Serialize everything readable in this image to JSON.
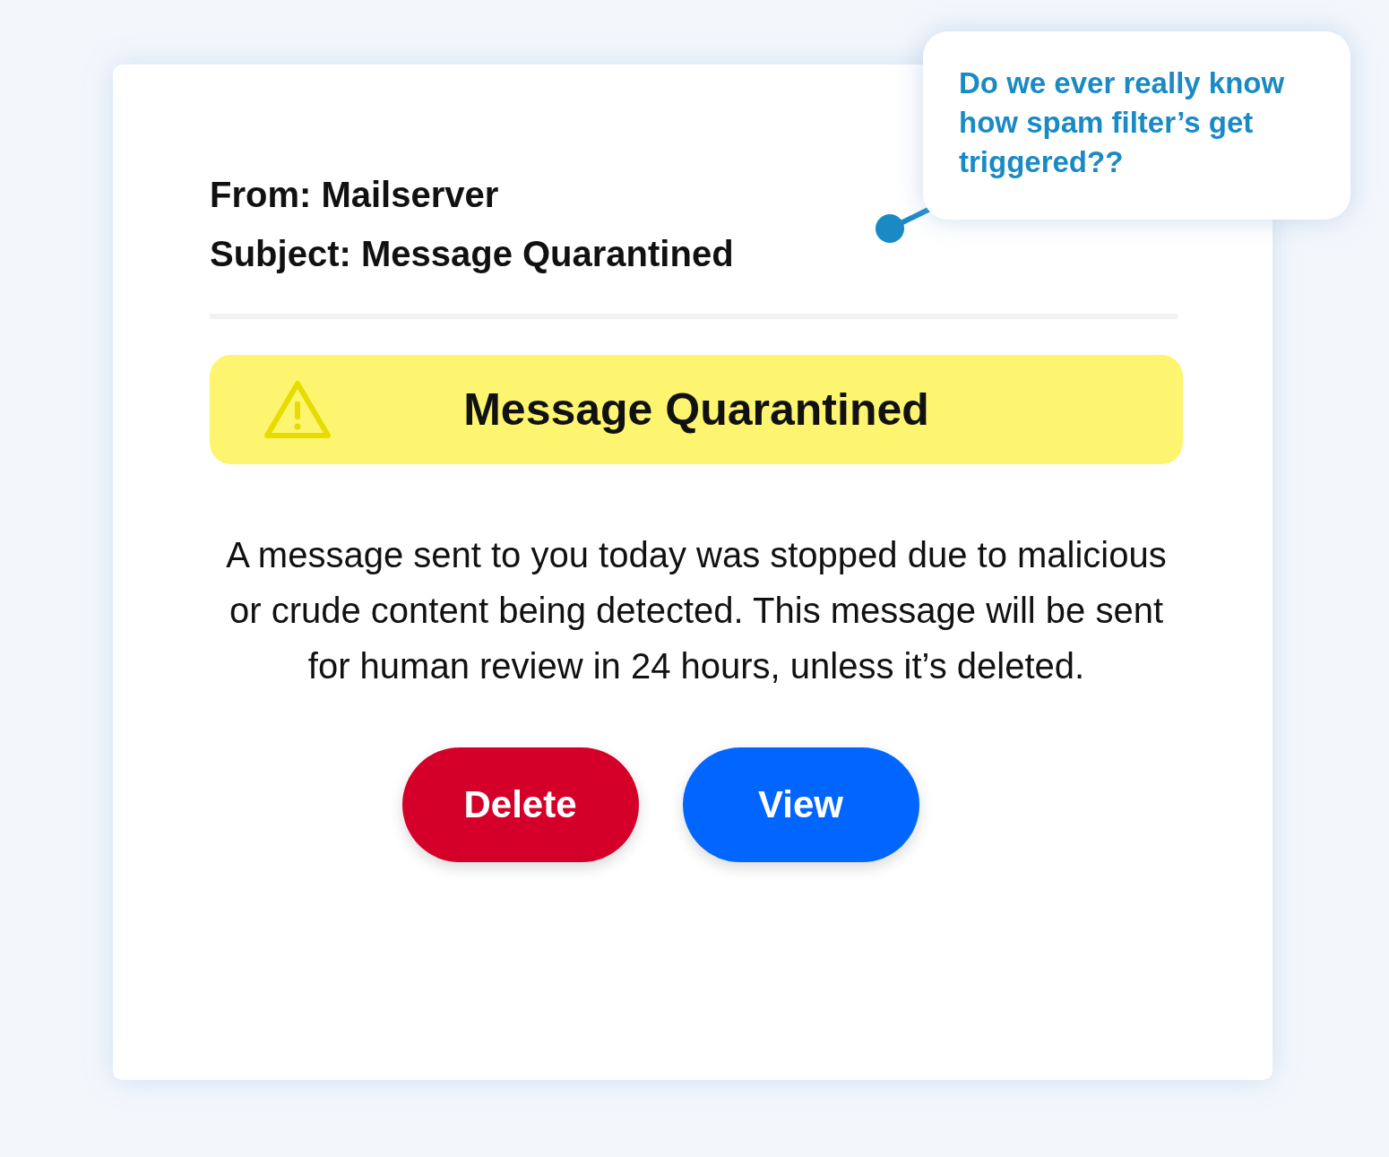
{
  "email": {
    "from": "From: Mailserver",
    "subject": "Subject: Message Quarantined"
  },
  "banner": {
    "title": "Message Quarantined"
  },
  "message": "A message sent to you today was stopped due to malicious or crude content being detected. This message will be sent for human review in 24 hours, unless it’s deleted.",
  "buttons": [
    {
      "label": "Delete",
      "kind": "danger"
    },
    {
      "label": "View",
      "kind": "primary"
    }
  ],
  "note": {
    "text": "Do we ever really know how spam filter’s get triggered??"
  }
}
